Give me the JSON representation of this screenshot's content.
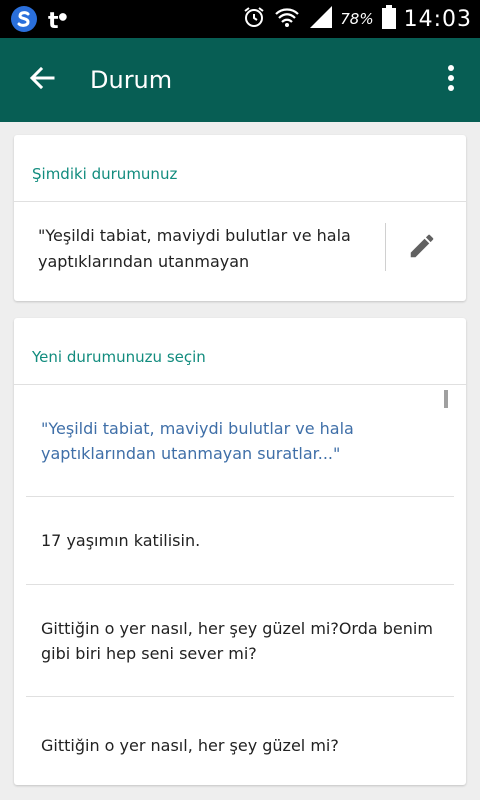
{
  "status_bar": {
    "battery_percent": "78%",
    "time": "14:03",
    "app_notification_text": "t"
  },
  "toolbar": {
    "title": "Durum"
  },
  "current_section": {
    "label": "Şimdiki durumunuz",
    "status_text": "\"Yeşildi tabiat, maviydi bulutlar ve hala yaptıklarından utanmayan"
  },
  "choose_section": {
    "label": "Yeni durumunuzu seçin",
    "items": [
      {
        "text": "\"Yeşildi tabiat, maviydi bulutlar ve hala yaptıklarından utanmayan suratlar...\""
      },
      {
        "text": "17 yaşımın katilisin."
      },
      {
        "text": "Gittiğin o yer nasıl, her şey güzel mi?Orda benim gibi biri hep seni sever mi?"
      },
      {
        "text": "Gittiğin o yer nasıl, her şey güzel mi?"
      }
    ]
  },
  "colors": {
    "toolbar": "#075e54",
    "accent": "#128c7e",
    "selected_text": "#3f6fa8"
  }
}
